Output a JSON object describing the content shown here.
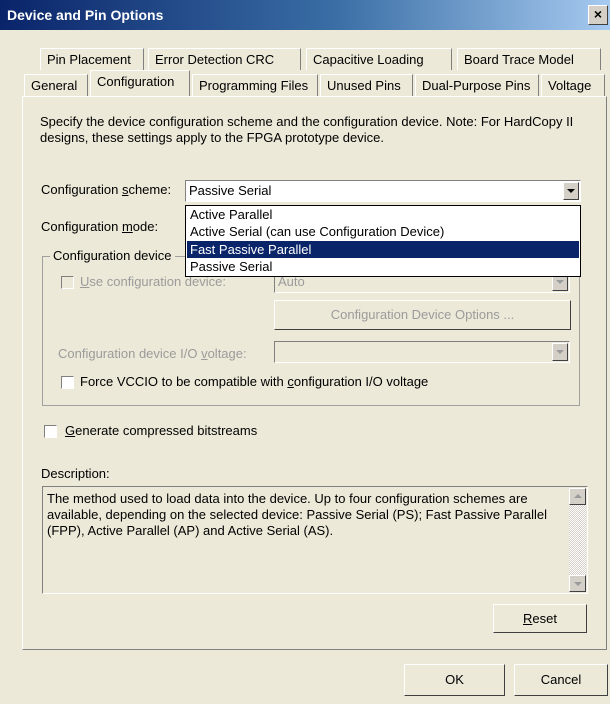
{
  "window": {
    "title": "Device and Pin Options",
    "close_glyph": "×"
  },
  "tabs_row1": [
    "Pin Placement",
    "Error Detection CRC",
    "Capacitive Loading",
    "Board Trace Model"
  ],
  "tabs_row2": [
    "General",
    "Configuration",
    "Programming Files",
    "Unused Pins",
    "Dual-Purpose Pins",
    "Voltage"
  ],
  "active_tab": "Configuration",
  "intro": "Specify the device configuration scheme and the configuration device. Note: For HardCopy II designs, these settings apply to the FPGA prototype device.",
  "scheme": {
    "label_pre": "Configuration ",
    "label_key": "s",
    "label_post": "cheme:",
    "value": "Passive Serial",
    "options": [
      "Active Parallel",
      "Active Serial (can use Configuration Device)",
      "Fast Passive Parallel",
      "Passive Serial"
    ],
    "highlighted": "Fast Passive Parallel"
  },
  "mode": {
    "label_pre": "Configuration ",
    "label_key": "m",
    "label_post": "ode:"
  },
  "group": {
    "title": "Configuration device",
    "use_device": {
      "key": "U",
      "label": "se configuration device:",
      "checked": false,
      "enabled": false
    },
    "device_value": "Auto",
    "options_button": "Configuration Device Options ...",
    "io_voltage": {
      "label_pre": "Configuration device I/O ",
      "label_key": "v",
      "label_post": "oltage:",
      "value": ""
    },
    "force_vccio": {
      "label_pre": "Force VCCIO to be compatible with ",
      "label_key": "c",
      "label_post": "onfiguration I/O voltage",
      "checked": false
    }
  },
  "compressed": {
    "key": "G",
    "label": "enerate compressed bitstreams",
    "checked": false
  },
  "description": {
    "label": "Description:",
    "text": "The method used to load data into the device. Up to four configuration schemes are available, depending on the selected device: Passive Serial (PS); Fast Passive Parallel (FPP), Active Parallel (AP) and Active Serial (AS)."
  },
  "buttons": {
    "reset_key": "R",
    "reset_rest": "eset",
    "ok": "OK",
    "cancel": "Cancel"
  },
  "icons": {
    "close": "close-icon",
    "dropdown": "chevron-down-icon",
    "scroll_up": "arrow-up-icon",
    "scroll_down": "arrow-down-icon"
  }
}
